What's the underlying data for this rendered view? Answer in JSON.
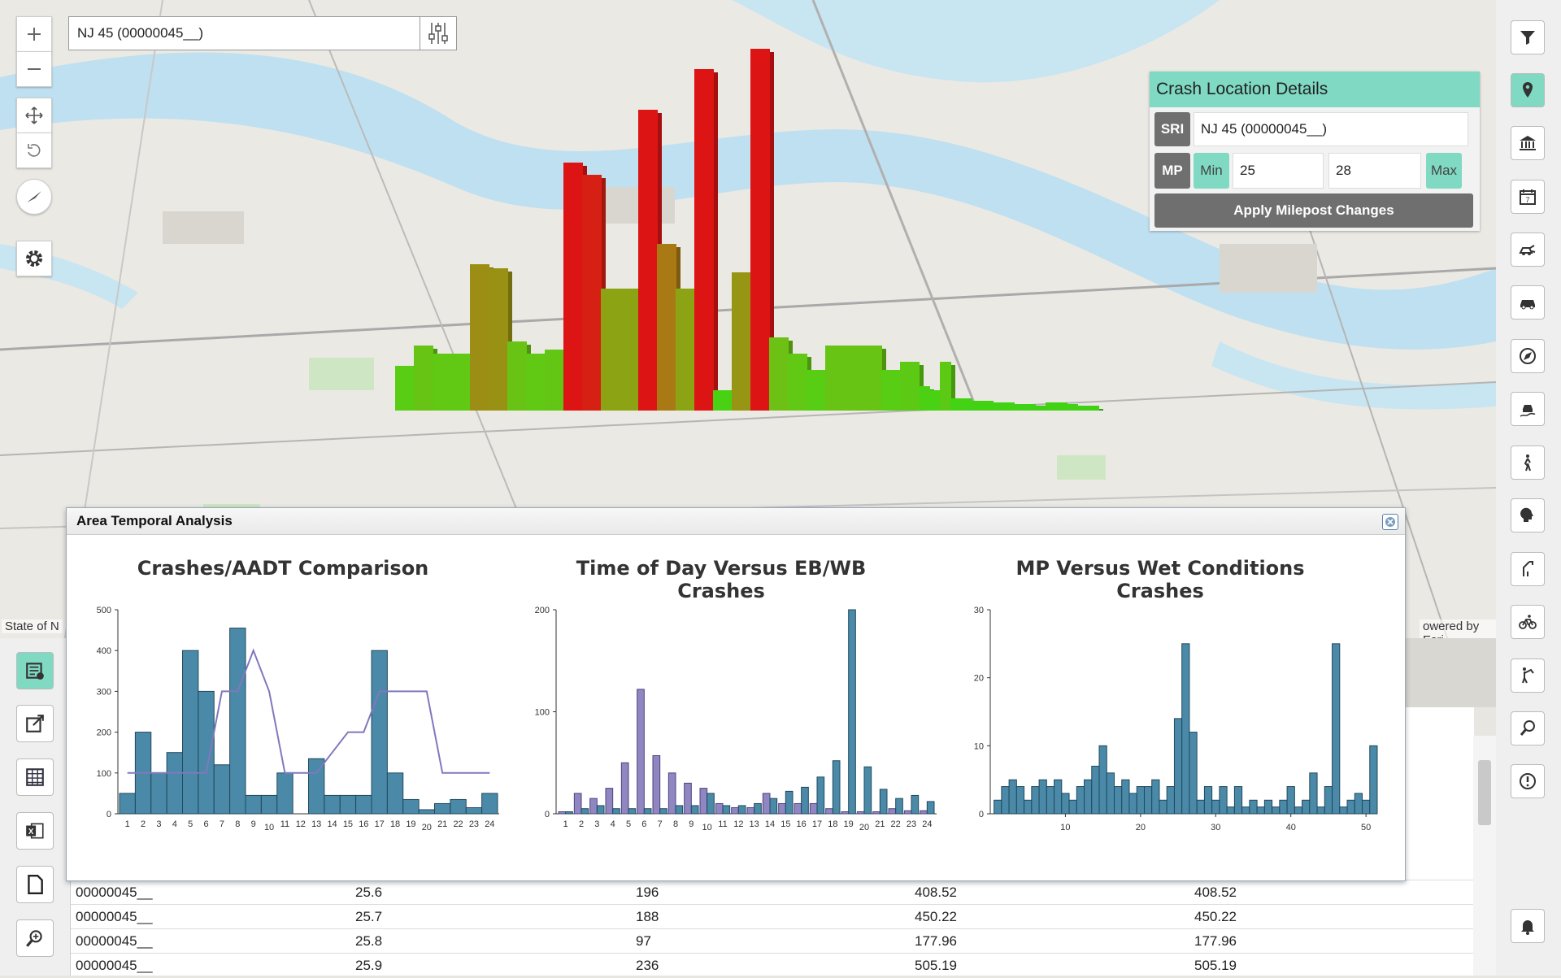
{
  "search": {
    "value": "NJ 45 (00000045__)"
  },
  "map": {
    "attribution_left": "State of N",
    "attribution_right": "owered by Esri"
  },
  "crash_details": {
    "title": "Crash Location Details",
    "sri_label": "SRI",
    "sri_value": "NJ 45 (00000045__)",
    "mp_label": "MP",
    "min_label": "Min",
    "min_value": "25",
    "max_value": "28",
    "max_label": "Max",
    "apply_label": "Apply Milepost Changes"
  },
  "panel": {
    "title": "Area Temporal Analysis"
  },
  "colors": {
    "accent": "#7fd9c3",
    "bar": "#4a8aa8",
    "bar_alt": "#8f86c2",
    "line": "#8078bd"
  },
  "chart_data": [
    {
      "type": "bar",
      "title": "Crashes/AADT Comparison",
      "categories": [
        "1",
        "2",
        "3",
        "4",
        "5",
        "6",
        "7",
        "8",
        "9",
        "10",
        "11",
        "12",
        "13",
        "14",
        "15",
        "16",
        "17",
        "18",
        "19",
        "20",
        "21",
        "22",
        "23",
        "24"
      ],
      "series": [
        {
          "values": [
            50,
            200,
            100,
            150,
            400,
            300,
            120,
            455,
            45,
            45,
            100,
            0,
            135,
            45,
            45,
            45,
            400,
            100,
            35,
            10,
            25,
            35,
            15,
            50
          ]
        },
        {
          "values": [
            100,
            100,
            100,
            100,
            100,
            100,
            300,
            300,
            400,
            300,
            100,
            100,
            100,
            150,
            200,
            200,
            300,
            300,
            300,
            300,
            100,
            100,
            100,
            100
          ]
        }
      ],
      "ylim": [
        0,
        500
      ],
      "yticks": [
        "0",
        "100",
        "200",
        "300",
        "400",
        "500"
      ]
    },
    {
      "type": "bar",
      "title": "Time of Day Versus EB/WB Crashes",
      "categories": [
        "1",
        "2",
        "3",
        "4",
        "5",
        "6",
        "7",
        "8",
        "9",
        "10",
        "11",
        "12",
        "13",
        "14",
        "15",
        "16",
        "17",
        "18",
        "19",
        "20",
        "21",
        "22",
        "23",
        "24"
      ],
      "series": [
        {
          "values": [
            2,
            20,
            15,
            25,
            50,
            122,
            57,
            40,
            30,
            25,
            10,
            6,
            6,
            20,
            10,
            10,
            10,
            5,
            2,
            2,
            2,
            5,
            3,
            3
          ]
        },
        {
          "values": [
            2,
            5,
            8,
            5,
            5,
            5,
            5,
            8,
            8,
            20,
            8,
            8,
            10,
            15,
            22,
            26,
            36,
            52,
            200,
            46,
            24,
            15,
            18,
            12
          ]
        }
      ],
      "ylim": [
        0,
        200
      ],
      "yticks": [
        "0",
        "100",
        "200"
      ]
    },
    {
      "type": "bar",
      "title": "MP Versus Wet Conditions Crashes",
      "x": [
        1,
        2,
        3,
        4,
        5,
        6,
        7,
        8,
        9,
        10,
        11,
        12,
        13,
        14,
        15,
        16,
        17,
        18,
        19,
        20,
        21,
        22,
        23,
        24,
        25,
        26,
        27,
        28,
        29,
        30,
        31,
        32,
        33,
        34,
        35,
        36,
        37,
        38,
        39,
        40,
        41,
        42,
        43,
        44,
        45,
        46,
        47,
        48,
        49,
        50,
        51
      ],
      "values": [
        2,
        4,
        5,
        4,
        2,
        4,
        5,
        4,
        5,
        3,
        2,
        4,
        5,
        7,
        10,
        6,
        4,
        5,
        3,
        4,
        4,
        5,
        2,
        4,
        14,
        25,
        12,
        2,
        4,
        2,
        4,
        1,
        4,
        1,
        2,
        1,
        2,
        1,
        2,
        4,
        1,
        2,
        6,
        1,
        4,
        25,
        1,
        2,
        3,
        2,
        10
      ],
      "ylim": [
        0,
        30
      ],
      "yticks": [
        "0",
        "10",
        "20",
        "30"
      ],
      "xticks": [
        "10",
        "20",
        "30",
        "40",
        "50"
      ]
    }
  ],
  "table": {
    "rows": [
      [
        "00000045__",
        "25.6",
        "196",
        "408.52",
        "408.52"
      ],
      [
        "00000045__",
        "25.7",
        "188",
        "450.22",
        "450.22"
      ],
      [
        "00000045__",
        "25.8",
        "97",
        "177.96",
        "177.96"
      ],
      [
        "00000045__",
        "25.9",
        "236",
        "505.19",
        "505.19"
      ]
    ]
  },
  "icons": {
    "right_toolbar": [
      "filter-icon",
      "location-pin-icon",
      "bank-icon",
      "calendar-icon",
      "vehicle-crash-icon",
      "car-icon",
      "compass-icon",
      "car-skid-icon",
      "pedestrian-icon",
      "head-icon",
      "road-turn-icon",
      "bicycle-icon",
      "worker-icon",
      "search-person-icon",
      "alert-circle-icon",
      "bell-icon"
    ],
    "left_toolbar": [
      "table-add-icon",
      "external-edit-icon",
      "table-icon",
      "excel-icon",
      "document-icon",
      "zoom-search-icon"
    ]
  }
}
